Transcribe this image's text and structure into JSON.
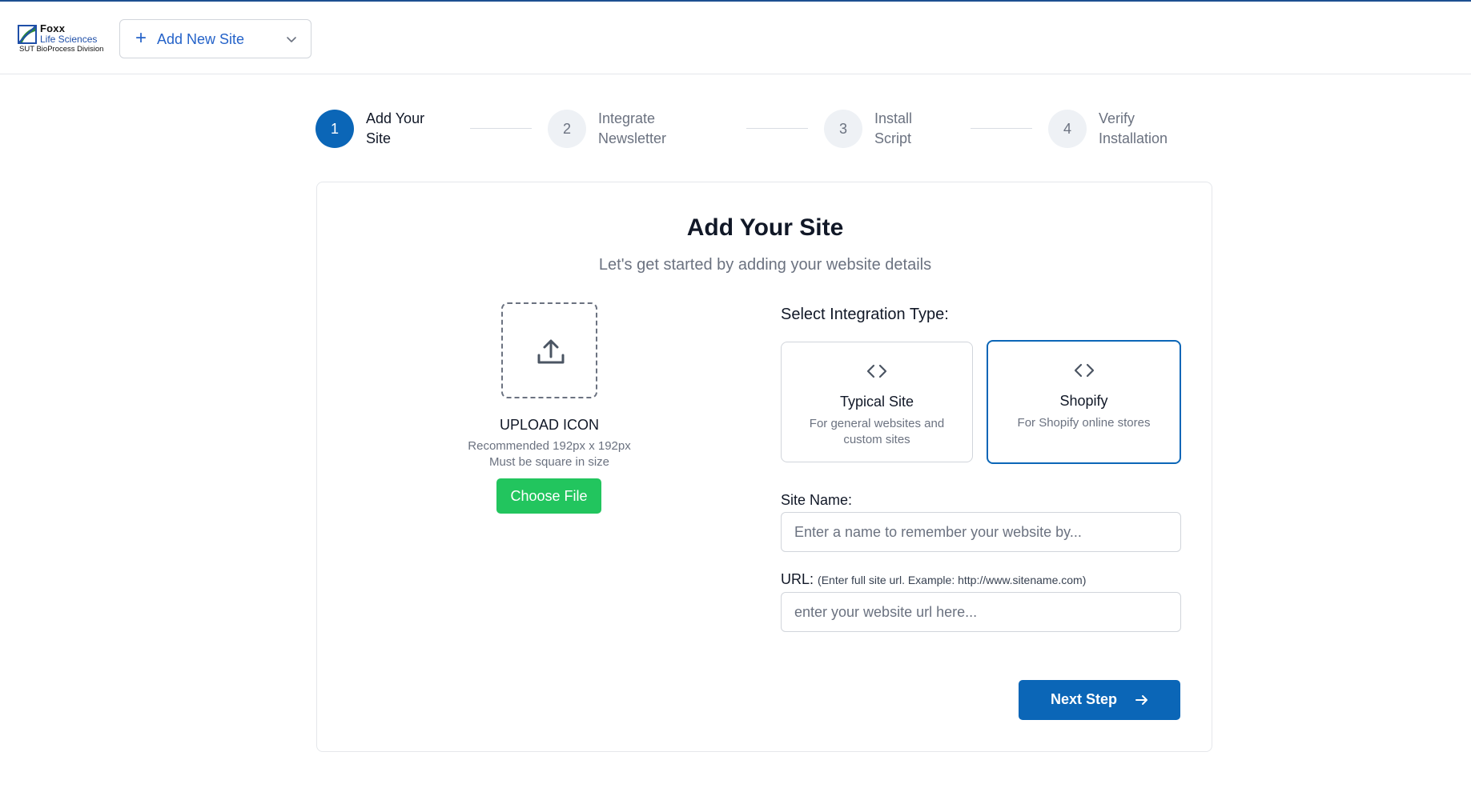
{
  "header": {
    "logo": {
      "name": "Foxx",
      "subname": "Life Sciences",
      "division": "SUT BioProcess Division"
    },
    "site_selector": {
      "label": "Add New Site",
      "icon": "plus-icon",
      "chevron": "chevron-down-icon"
    }
  },
  "stepper": {
    "steps": [
      {
        "number": "1",
        "line1": "Add Your",
        "line2": "Site",
        "state": "active"
      },
      {
        "number": "2",
        "line1": "Integrate",
        "line2": "Newsletter",
        "state": "inactive"
      },
      {
        "number": "3",
        "line1": "Install",
        "line2": "Script",
        "state": "inactive"
      },
      {
        "number": "4",
        "line1": "Verify",
        "line2": "Installation",
        "state": "inactive"
      }
    ]
  },
  "form": {
    "title": "Add Your Site",
    "subtitle": "Let's get started by adding your website details",
    "upload": {
      "icon": "upload-icon",
      "title": "UPLOAD ICON",
      "note1": "Recommended 192px x 192px",
      "note2": "Must be square in size",
      "button": "Choose File"
    },
    "integration": {
      "label": "Select Integration Type:",
      "options": [
        {
          "icon": "code-icon",
          "name": "Typical Site",
          "description": "For general websites and custom sites",
          "selected": false
        },
        {
          "icon": "code-icon",
          "name": "Shopify",
          "description": "For Shopify online stores",
          "selected": true
        }
      ]
    },
    "site_name": {
      "label": "Site Name:",
      "placeholder": "Enter a name to remember your website by...",
      "value": ""
    },
    "url": {
      "label": "URL:",
      "hint": "(Enter full site url. Example: http://www.sitename.com)",
      "placeholder": "enter your website url here...",
      "value": ""
    },
    "next_button": {
      "label": "Next Step",
      "icon": "arrow-right-icon"
    }
  },
  "colors": {
    "primary": "#0b66b7",
    "success": "#22c55e",
    "link": "#2563c9",
    "muted": "#6b7280"
  }
}
